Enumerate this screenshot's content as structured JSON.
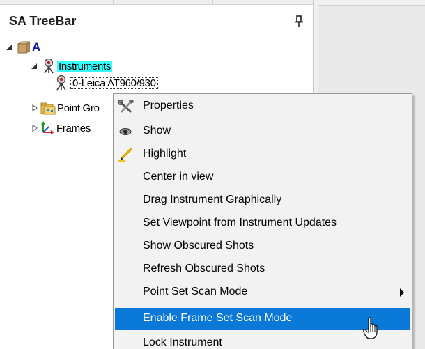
{
  "panel": {
    "title": "SA TreeBar",
    "pin_icon": "pin-icon"
  },
  "tree": {
    "root": {
      "label": "A",
      "icon": "package-icon",
      "expanded": true
    },
    "instruments": {
      "label": "Instruments",
      "icon": "instrument-icon",
      "expanded": true,
      "selected": true
    },
    "instrument_item": {
      "label": "0-Leica AT960/930",
      "icon": "instrument-icon"
    },
    "point_groups": {
      "label": "Point Gro",
      "icon": "point-group-folder-icon",
      "expanded": false
    },
    "frames": {
      "label": "Frames",
      "icon": "frame-axes-icon",
      "expanded": false
    }
  },
  "context_menu": {
    "items": [
      {
        "label": "Properties",
        "icon": "tools-icon"
      },
      {
        "label": "Show",
        "icon": "eye-icon"
      },
      {
        "label": "Highlight",
        "icon": "highlighter-icon"
      },
      {
        "label": "Center in view"
      },
      {
        "label": "Drag Instrument Graphically"
      },
      {
        "label": "Set Viewpoint from Instrument Updates"
      },
      {
        "label": "Show Obscured Shots"
      },
      {
        "label": "Refresh Obscured Shots"
      },
      {
        "label": "Point Set Scan Mode",
        "has_submenu": true
      },
      {
        "label": "Enable Frame Set Scan Mode",
        "highlighted": true
      },
      {
        "label": "Lock Instrument"
      }
    ]
  },
  "colors": {
    "selection_cyan": "#33ffff",
    "menu_highlight": "#0a78d7",
    "root_label": "#1a1aa8"
  },
  "cursor": "hand-pointer-icon"
}
